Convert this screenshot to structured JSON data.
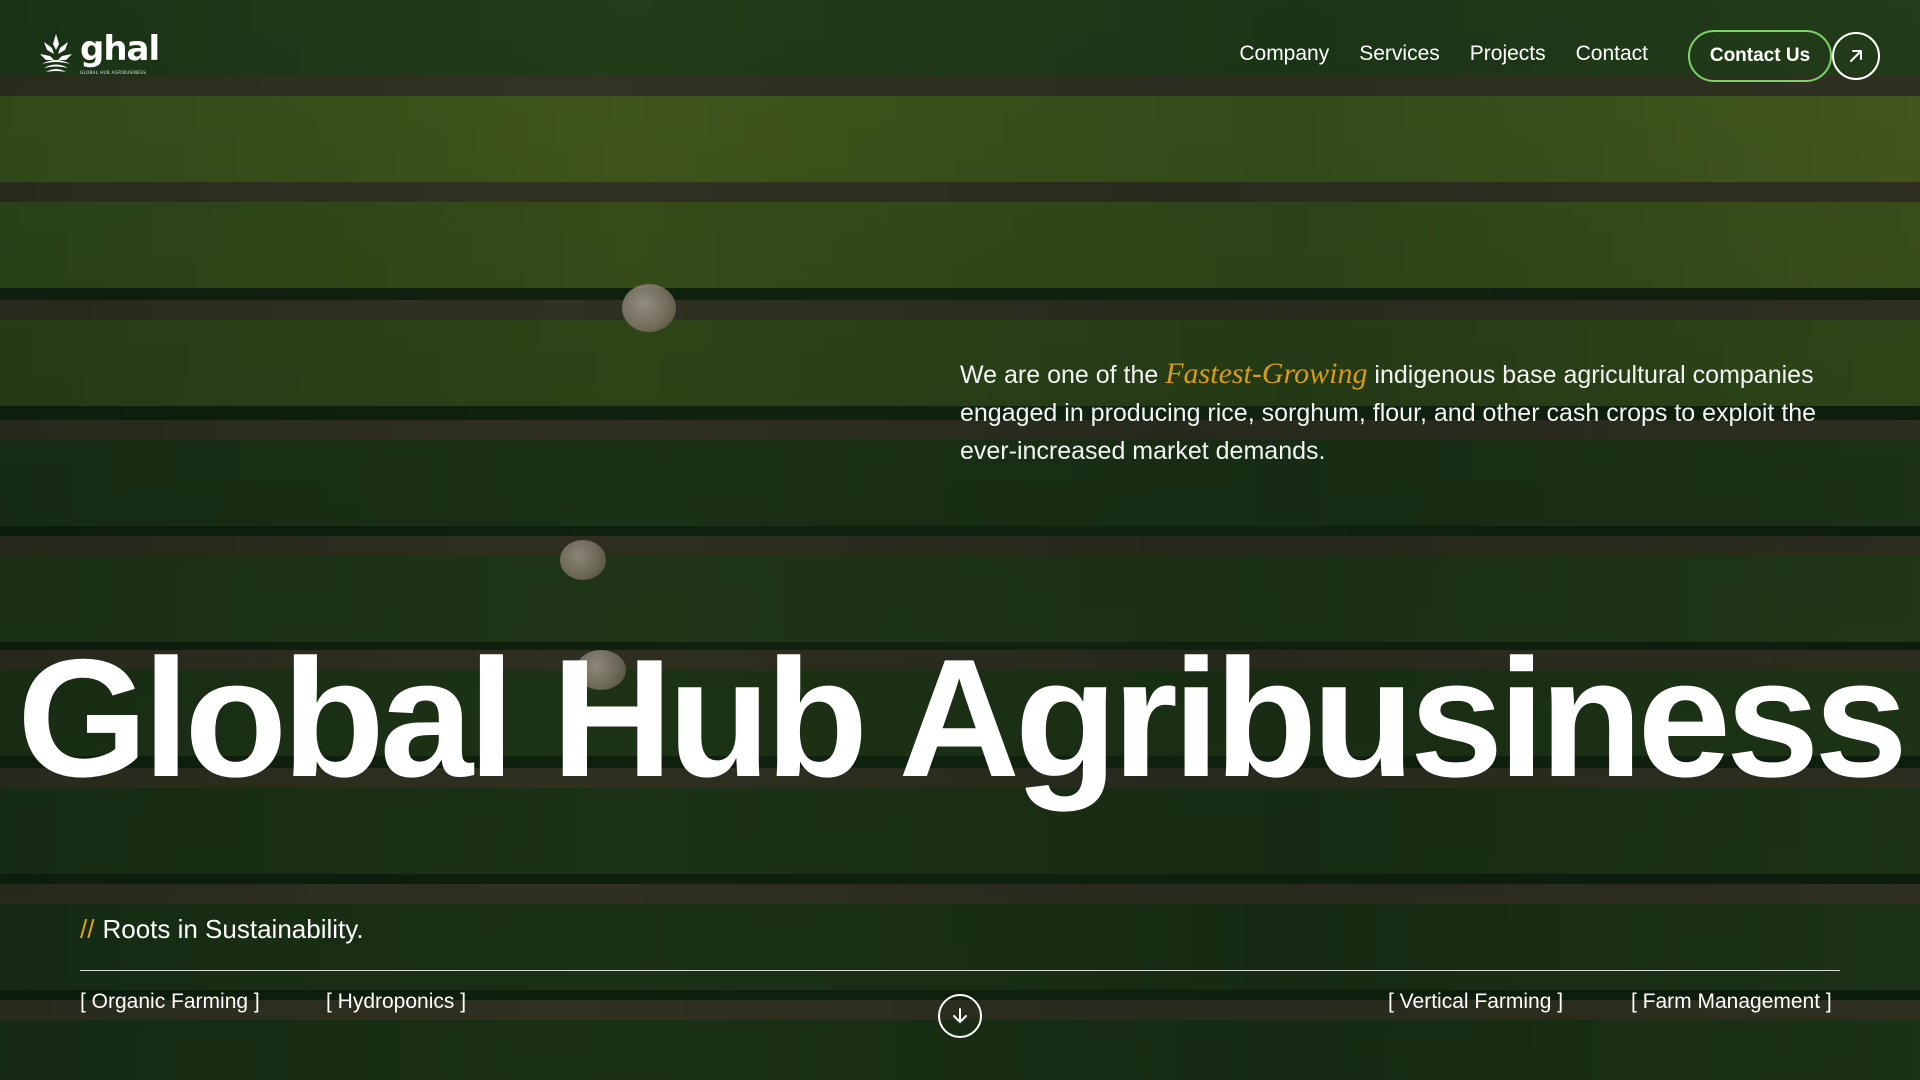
{
  "brand": {
    "name": "ghal",
    "tagline": "GLOBAL HUB AGRIBUSINESS"
  },
  "nav": {
    "items": [
      {
        "label": "Company"
      },
      {
        "label": "Services"
      },
      {
        "label": "Projects"
      },
      {
        "label": "Contact"
      }
    ],
    "cta_label": "Contact Us",
    "cta_icon": "arrow-up-right-icon"
  },
  "intro": {
    "before": "We are one of the ",
    "highlight": "Fastest-Growing",
    "after": " indigenous base agricultural companies engaged in producing rice, sorghum, flour, and other cash crops to exploit the ever-increased market demands."
  },
  "hero": {
    "title": "Global Hub Agribusiness"
  },
  "bottom": {
    "tagline_prefix": "//",
    "tagline": "Roots in Sustainability.",
    "services": [
      "[ Organic Farming ]",
      "[ Hydroponics ]",
      "[ Vertical Farming ]",
      "[ Farm Management ]"
    ],
    "scroll_icon": "arrow-down-circle-icon"
  },
  "colors": {
    "accent_gold": "#d99a1e",
    "cta_border_green": "#7dd36a",
    "field_dark_green": "#163016"
  }
}
